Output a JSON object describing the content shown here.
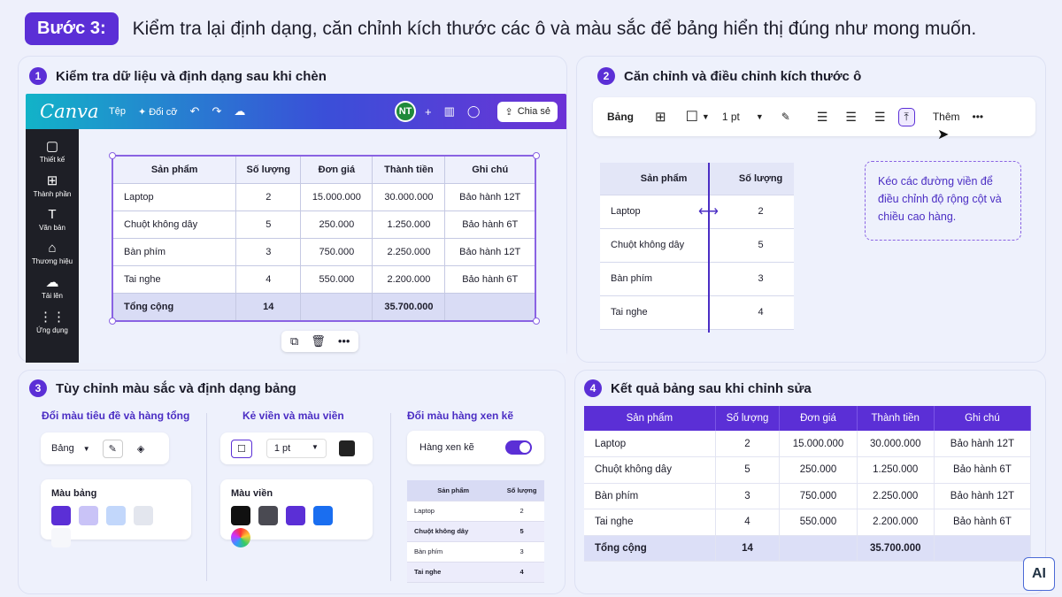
{
  "header": {
    "step": "Bước 3:",
    "text": "Kiểm tra lại định dạng, căn chỉnh kích thước các ô và màu sắc để bảng hiển thị đúng như mong muốn."
  },
  "panel1": {
    "num": "1",
    "title": "Kiểm tra dữ liệu và định dạng sau khi chèn",
    "canva": {
      "logo": "Canva",
      "menu_file": "Tệp",
      "menu_resize": "✦ Đổi cỡ",
      "avatar": "NT",
      "share": "Chia sẻ"
    },
    "sidebar": [
      {
        "icon": "▢",
        "label": "Thiết kế"
      },
      {
        "icon": "⊞",
        "label": "Thành phần"
      },
      {
        "icon": "T",
        "label": "Văn bản"
      },
      {
        "icon": "⌂",
        "label": "Thương hiệu"
      },
      {
        "icon": "☁",
        "label": "Tải lên"
      },
      {
        "icon": "⋮⋮",
        "label": "Ứng dụng"
      }
    ],
    "table": {
      "headers": [
        "Sản phẩm",
        "Số lượng",
        "Đơn giá",
        "Thành tiền",
        "Ghi chú"
      ],
      "rows": [
        [
          "Laptop",
          "2",
          "15.000.000",
          "30.000.000",
          "Bảo hành 12T"
        ],
        [
          "Chuột không dây",
          "5",
          "250.000",
          "1.250.000",
          "Bảo hành 6T"
        ],
        [
          "Bàn phím",
          "3",
          "750.000",
          "2.250.000",
          "Bảo hành 12T"
        ],
        [
          "Tai nghe",
          "4",
          "550.000",
          "2.200.000",
          "Bảo hành 6T"
        ]
      ],
      "total": [
        "Tổng cộng",
        "14",
        "",
        "35.700.000",
        ""
      ]
    }
  },
  "panel2": {
    "num": "2",
    "title": "Căn chỉnh và điều chỉnh kích thước ô",
    "toolbar": {
      "table_label": "Bảng",
      "border_size": "1 pt",
      "more": "Thêm"
    },
    "table": {
      "headers": [
        "Sản phẩm",
        "Số lượng"
      ],
      "rows": [
        [
          "Laptop",
          "2"
        ],
        [
          "Chuột không dây",
          "5"
        ],
        [
          "Bàn phím",
          "3"
        ],
        [
          "Tai nghe",
          "4"
        ]
      ]
    },
    "note": "Kéo các đường viền để điều chỉnh độ rộng cột và chiều cao hàng."
  },
  "panel3": {
    "num": "3",
    "title": "Tùy chỉnh màu sắc và định dạng bảng",
    "col1": {
      "title": "Đổi màu tiêu đề và hàng tổng",
      "table_label": "Bảng",
      "palette_title": "Màu bảng",
      "colors": [
        "#5b2fd6",
        "#c9c3f7",
        "#c2d7fb",
        "#e3e6ee",
        "#f6f7fb"
      ]
    },
    "col2": {
      "title": "Kẻ viền và màu viền",
      "border_size": "1 pt",
      "palette_title": "Màu viền",
      "colors": [
        "#111111",
        "#4a4a52",
        "#5b2fd6",
        "#1a6ef0",
        "#12b3c8"
      ]
    },
    "col3": {
      "title": "Đổi màu hàng xen kẽ",
      "toggle_label": "Hàng xen kẽ",
      "table": {
        "headers": [
          "Sản phẩm",
          "Số lượng"
        ],
        "rows": [
          [
            "Laptop",
            "2"
          ],
          [
            "Chuột không dây",
            "5"
          ],
          [
            "Bàn phím",
            "3"
          ],
          [
            "Tai nghe",
            "4"
          ]
        ]
      }
    }
  },
  "panel4": {
    "num": "4",
    "title": "Kết quả bảng sau khi chỉnh sửa",
    "table": {
      "headers": [
        "Sản phẩm",
        "Số lượng",
        "Đơn giá",
        "Thành tiền",
        "Ghi chú"
      ],
      "rows": [
        [
          "Laptop",
          "2",
          "15.000.000",
          "30.000.000",
          "Bảo hành 12T"
        ],
        [
          "Chuột không dây",
          "5",
          "250.000",
          "1.250.000",
          "Bảo hành 6T"
        ],
        [
          "Bàn phím",
          "3",
          "750.000",
          "2.250.000",
          "Bảo hành 12T"
        ],
        [
          "Tai nghe",
          "4",
          "550.000",
          "2.200.000",
          "Bảo hành 6T"
        ]
      ],
      "total": [
        "Tổng cộng",
        "14",
        "",
        "35.700.000",
        ""
      ]
    }
  },
  "logo": "AI"
}
